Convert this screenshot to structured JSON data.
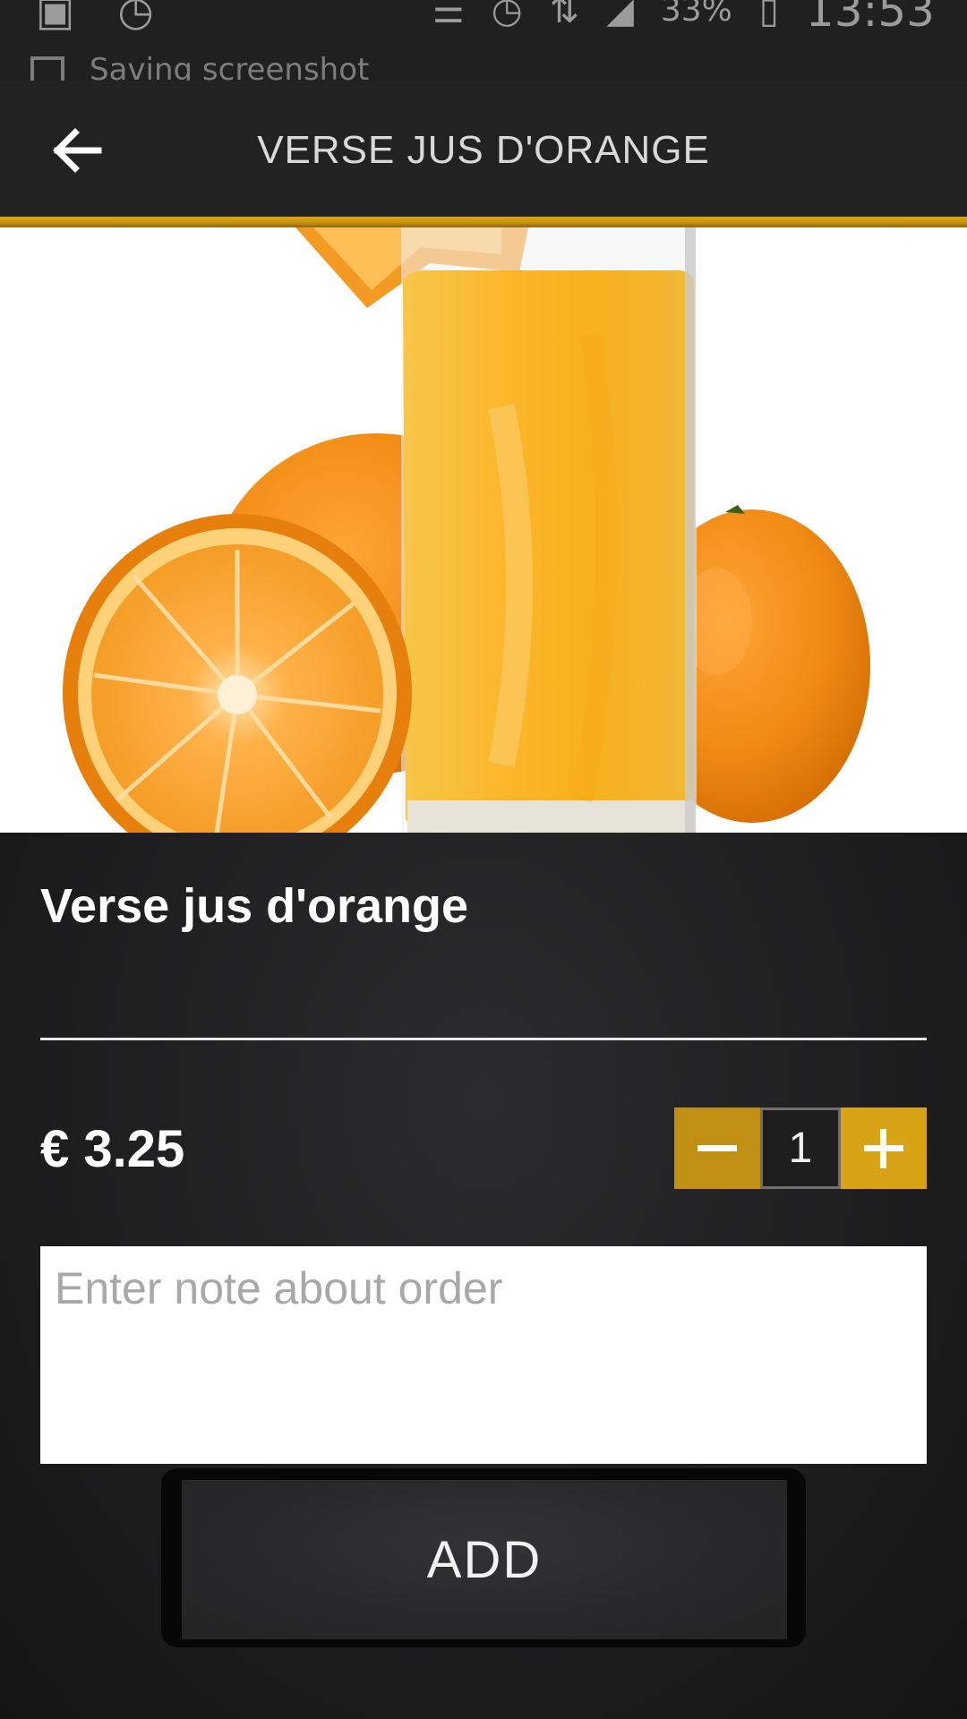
{
  "status_bar": {
    "battery": "33%",
    "time": "13:53",
    "notification_text": "Saving screenshot",
    "icons": [
      "image-icon",
      "timer-icon",
      "mute-vibrate-icon",
      "alarm-icon",
      "data-transfer-icon",
      "signal-icon",
      "battery-charging-icon"
    ]
  },
  "app_bar": {
    "title": "VERSE JUS D'ORANGE",
    "back_icon": "arrow-left-icon"
  },
  "product": {
    "name": "Verse jus d'orange",
    "price": "€ 3.25",
    "quantity": "1",
    "note_placeholder": "Enter note about order",
    "note_value": "",
    "add_label": "ADD",
    "image_subject": "glass of orange juice with oranges"
  },
  "colors": {
    "accent_gold": "#c08f13",
    "accent_gold_light": "#d8a416",
    "app_bar_bg": "#222222",
    "panel_bg": "#1c1c1d"
  }
}
